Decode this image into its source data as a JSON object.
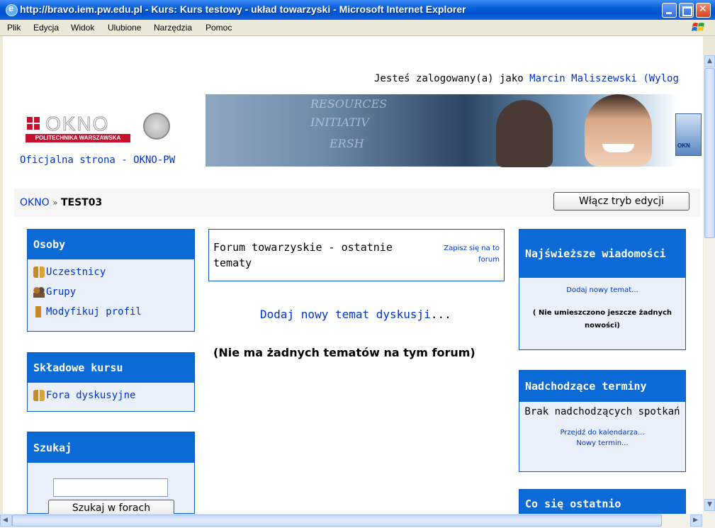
{
  "window": {
    "title": "http://bravo.iem.pw.edu.pl - Kurs: Kurs testowy - układ towarzyski - Microsoft Internet Explorer"
  },
  "menu": [
    "Plik",
    "Edycja",
    "Widok",
    "Ulubione",
    "Narzędzia",
    "Pomoc"
  ],
  "header": {
    "login_prefix": "Jesteś zalogowany(a) jako",
    "user_name": "Marcin Maliszewski",
    "logout_fragment": "(Wylog",
    "logo_word": "OKNO",
    "logo_sub": "POLITECHNIKA WARSZAWSKA",
    "official_link": "Oficjalna strona - OKNO-PW",
    "banner_words": [
      "RESOURCES",
      "INITIATIV",
      "ERSH"
    ],
    "mini_logo": "OKN"
  },
  "nav": {
    "home": "OKNO",
    "separator": "»",
    "current": "TEST03",
    "edit_button": "Włącz tryb edycji"
  },
  "left": {
    "osoby": {
      "title": "Osoby",
      "items": [
        "Uczestnicy",
        "Grupy",
        "Modyfikuj profil"
      ]
    },
    "skladowe": {
      "title": "Składowe kursu",
      "items": [
        "Fora dyskusyjne"
      ]
    },
    "szukaj": {
      "title": "Szukaj",
      "button": "Szukaj w forach"
    }
  },
  "center": {
    "forum_title": "Forum towarzyskie - ostatnie tematy",
    "subscribe": "Zapisz się na to forum",
    "add_topic": "Dodaj nowy temat dyskusji",
    "add_topic_dots": "...",
    "no_topics": "(Nie ma żadnych tematów na tym forum)"
  },
  "right": {
    "news": {
      "title": "Najświeższe wiadomości",
      "add": "Dodaj nowy temat...",
      "empty": "( Nie umieszczono jeszcze żadnych nowości)"
    },
    "events": {
      "title": "Nadchodzące terminy",
      "none": "Brak nadchodzących spotkań",
      "calendar": "Przejdź do kalendarza...",
      "new_event": "Nowy termin..."
    },
    "recent": {
      "title": "Co się ostatnio"
    }
  },
  "colors": {
    "block_header": "#0b6ad6",
    "block_bg": "#e9f0fa",
    "link": "#0033cc"
  }
}
